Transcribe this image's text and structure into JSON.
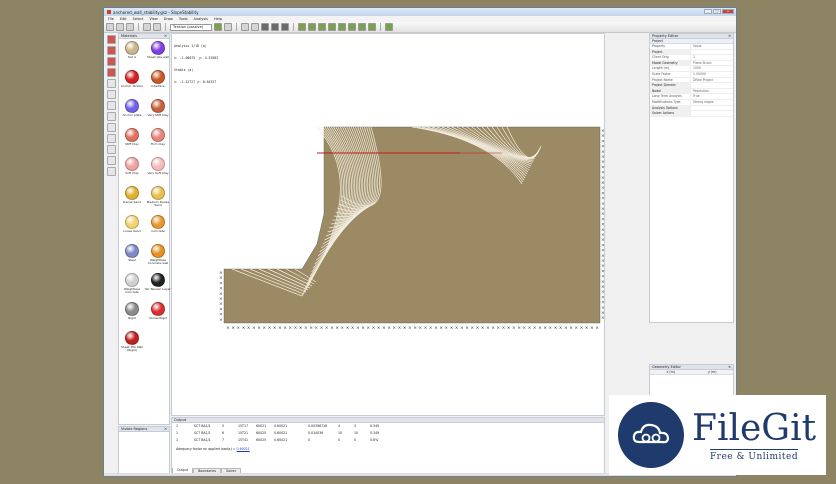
{
  "window": {
    "title": "anchored_wall_stability.gsz - SlopeStability",
    "controls": {
      "min": "_",
      "max": "□",
      "close": "x"
    }
  },
  "menu": [
    "File",
    "Edit",
    "Select",
    "View",
    "Draw",
    "Tools",
    "Analysis",
    "Help"
  ],
  "toolbar": {
    "material_select": "Tension (passive)"
  },
  "materials_panel": {
    "title": "Materials",
    "items": [
      {
        "label": "Soil A",
        "color": "#c8b48a"
      },
      {
        "label": "Sheet pile wall",
        "color": "#8040e0"
      },
      {
        "label": "Anchor Tendon",
        "color": "#d42020"
      },
      {
        "label": "Interface",
        "color": "#c85a28"
      },
      {
        "label": "Anchor plate",
        "color": "#7060e8"
      },
      {
        "label": "Very Stiff Clay",
        "color": "#c8603a"
      },
      {
        "label": "Stiff Clay",
        "color": "#e07060"
      },
      {
        "label": "Firm Clay",
        "color": "#e8857a"
      },
      {
        "label": "Soft Clay",
        "color": "#f2a0a0"
      },
      {
        "label": "Very Soft Clay",
        "color": "#f5bcbc"
      },
      {
        "label": "Dense Sand",
        "color": "#e0b030"
      },
      {
        "label": "Medium Dense Sand",
        "color": "#e8c050"
      },
      {
        "label": "Loose Sand",
        "color": "#f0d470"
      },
      {
        "label": "Concrete",
        "color": "#e89830"
      },
      {
        "label": "Steel",
        "color": "#7c88c8"
      },
      {
        "label": "Weightless Concrete wall",
        "color": "#e89020"
      },
      {
        "label": "Weightless Concrete",
        "color": "#d0d0d0"
      },
      {
        "label": "No Tension Layer",
        "color": "#222222"
      },
      {
        "label": "Rigid",
        "color": "#8a8a8a"
      },
      {
        "label": "Varnel Rigid",
        "color": "#d83030"
      },
      {
        "label": "Sheet Pile Wall (Rigid)",
        "color": "#c02020"
      }
    ]
  },
  "visible_regions": {
    "title": "Visible Regions"
  },
  "canvas": {
    "stats": [
      "Analysis 1/18 (a)",
      "x: -1.00075  y: 4.53583",
      "Stable (a)",
      "x: -1.12727 y: 8.64327"
    ],
    "soil_color": "#9b8a63"
  },
  "output": {
    "title": "Output",
    "rows": [
      [
        "1",
        "SCT BA1/1",
        "5",
        "15T17",
        "60021",
        "0.60021",
        "0.00398728",
        "4",
        "3",
        "0.349"
      ],
      [
        "1",
        "SCT BA1/1",
        "6",
        "15T21",
        "60025",
        "0.60021",
        "0.034036",
        "10",
        "10",
        "0.349"
      ],
      [
        "1",
        "SCT BA1/1",
        "7",
        "15T41",
        "60025",
        "0.60021",
        "0",
        "0",
        "0",
        "0.8%"
      ]
    ],
    "safety_label": "Adequacy factor on applied load(s) = ",
    "safety_value": "0.60021",
    "tabs": [
      "Output",
      "Boundaries",
      "Solver"
    ]
  },
  "property_editor": {
    "title": "Property Editor",
    "section": "Project",
    "rows": [
      {
        "k": "Property",
        "v": "Value",
        "sec": false
      },
      {
        "k": "Project",
        "v": "",
        "sec": true
      },
      {
        "k": "Client Ortg",
        "v": "1",
        "sec": false
      },
      {
        "k": "Model Geometry",
        "v": "Plane Strain",
        "sec": true
      },
      {
        "k": "Length (m)",
        "v": "1000",
        "sec": false
      },
      {
        "k": "Scale Factor",
        "v": "1.00000",
        "sec": false
      },
      {
        "k": "Project Name",
        "v": "Dflow Project",
        "sec": false
      },
      {
        "k": "Project Domain",
        "v": "",
        "sec": true
      },
      {
        "k": "Nodal",
        "v": "Resolution",
        "sec": true
      },
      {
        "k": "Long Term Analysis",
        "v": "True",
        "sec": false
      },
      {
        "k": "Modifications Type",
        "v": "Strong edges",
        "sec": false
      },
      {
        "k": "Analysis Options",
        "v": "",
        "sec": true
      },
      {
        "k": "Solver Actions",
        "v": "",
        "sec": true
      }
    ]
  },
  "geometry_editor": {
    "title": "Geometry Editor",
    "cols": [
      "x (m)",
      "y (m)"
    ]
  },
  "watermark": {
    "name": "FileGit",
    "tagline": "Free & Unlimited"
  }
}
